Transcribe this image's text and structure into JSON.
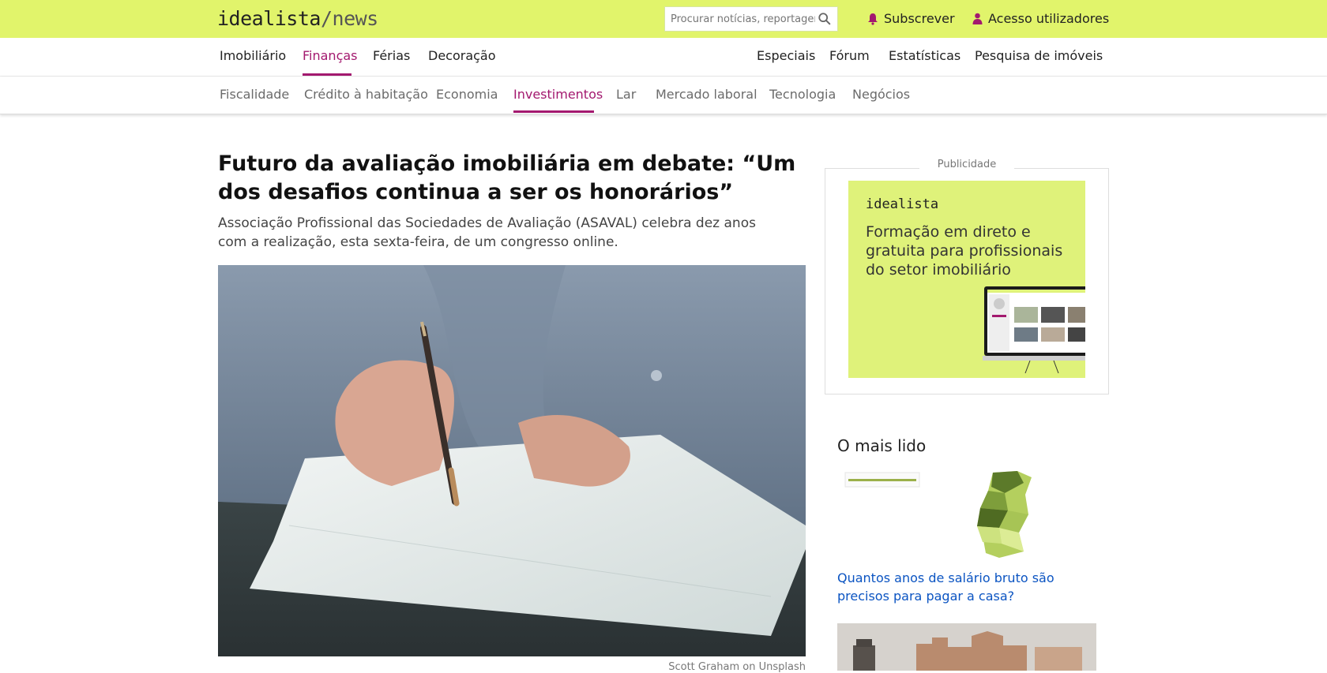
{
  "header": {
    "logo_main": "idealista",
    "logo_slash": "/news",
    "search_placeholder": "Procurar notícias, reportagens",
    "subscribe_label": "Subscrever",
    "login_label": "Acesso utilizadores"
  },
  "nav": {
    "left": [
      "Imobiliário",
      "Finanças",
      "Férias",
      "Decoração"
    ],
    "right": [
      "Especiais",
      "Fórum",
      "Estatísticas",
      "Pesquisa de imóveis"
    ],
    "active": "Finanças"
  },
  "subnav": {
    "items": [
      "Fiscalidade",
      "Crédito à habitação",
      "Economia",
      "Investimentos",
      "Lar",
      "Mercado laboral",
      "Tecnologia",
      "Negócios"
    ],
    "active": "Investimentos"
  },
  "article": {
    "headline": "Futuro da avaliação imobiliária em debate: “Um dos desafios continua a ser os honorários”",
    "lead": "Associação Profissional das Sociedades de Avaliação (ASAVAL) celebra dez anos com a realização, esta sexta-feira, de um congresso online.",
    "photo_credit": "Scott Graham on Unsplash"
  },
  "sidebar": {
    "ad_label": "Publicidade",
    "ad_logo": "idealista",
    "ad_text": "Formação em direto e gratuita para profissionais do setor imobiliário",
    "most_read_title": "O mais lido",
    "most_read_link": "Quantos anos de salário bruto são precisos para pagar a casa?"
  },
  "colors": {
    "brand_lime": "#e1f46b",
    "accent_magenta": "#a3196f",
    "link_blue": "#0b54c2"
  }
}
